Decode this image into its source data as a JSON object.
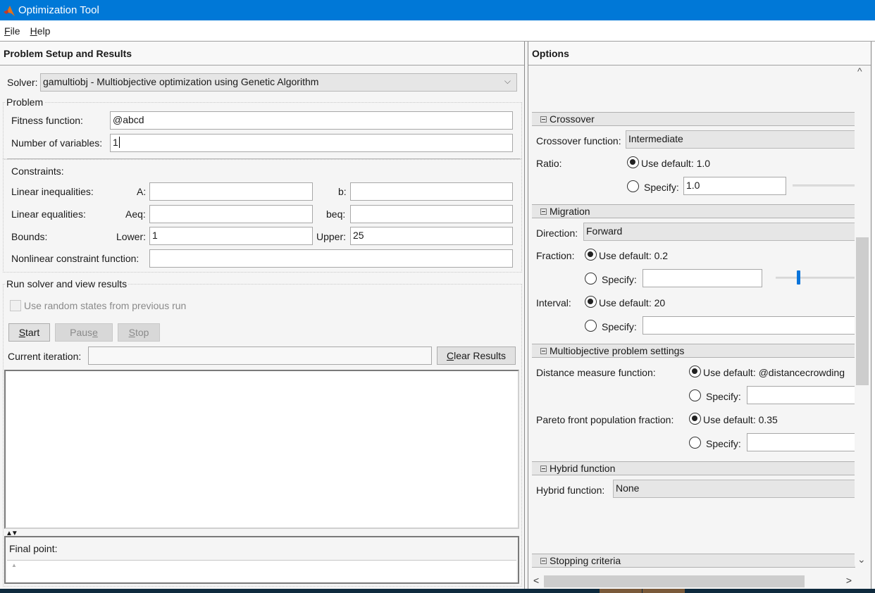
{
  "window": {
    "title": "Optimization Tool"
  },
  "menu": {
    "items": [
      {
        "label": "File",
        "mnemonic": "F",
        "rest": "ile"
      },
      {
        "label": "Help",
        "mnemonic": "H",
        "rest": "elp"
      }
    ]
  },
  "left_panel": {
    "title": "Problem Setup and Results",
    "solver": {
      "label": "Solver:",
      "value": "gamultiobj - Multiobjective optimization using Genetic Algorithm"
    },
    "problem": {
      "title": "Problem",
      "fitness_label": "Fitness function:",
      "fitness_value": "@abcd",
      "numvars_label": "Number of variables:",
      "numvars_value": "1"
    },
    "constraints": {
      "title": "Constraints:",
      "lin_ineq_label": "Linear inequalities:",
      "A_label": "A:",
      "A_value": "",
      "b_label": "b:",
      "b_value": "",
      "lin_eq_label": "Linear equalities:",
      "Aeq_label": "Aeq:",
      "Aeq_value": "",
      "beq_label": "beq:",
      "beq_value": "",
      "bounds_label": "Bounds:",
      "lower_label": "Lower:",
      "lower_value": "1",
      "upper_label": "Upper:",
      "upper_value": "25",
      "nonlin_label": "Nonlinear constraint function:",
      "nonlin_value": ""
    },
    "run": {
      "title": "Run solver and view results",
      "random_states_label": "Use random states from previous run",
      "random_states_checked": false,
      "start": {
        "mn": "S",
        "rest": "tart"
      },
      "pause": {
        "pre": "Paus",
        "mn": "e"
      },
      "stop": {
        "mn": "S",
        "rest": "top"
      },
      "current_iteration_label": "Current iteration:",
      "current_iteration_value": "",
      "clear_results": {
        "mn": "C",
        "rest": "lear Results"
      },
      "results_text": ""
    },
    "final_point": {
      "label": "Final point:",
      "value": ""
    }
  },
  "right_panel": {
    "title": "Options",
    "crossover": {
      "header": "Crossover",
      "function_label": "Crossover function:",
      "function_value": "Intermediate",
      "ratio_label": "Ratio:",
      "ratio_default": "Use default: 1.0",
      "ratio_default_selected": true,
      "ratio_specify": "Specify:",
      "ratio_specify_value": "1.0"
    },
    "migration": {
      "header": "Migration",
      "direction_label": "Direction:",
      "direction_value": "Forward",
      "fraction_label": "Fraction:",
      "fraction_default": "Use default: 0.2",
      "fraction_default_selected": true,
      "fraction_specify": "Specify:",
      "fraction_specify_value": "",
      "fraction_slider_value": 0.1,
      "interval_label": "Interval:",
      "interval_default": "Use default: 20",
      "interval_default_selected": true,
      "interval_specify": "Specify:",
      "interval_specify_value": ""
    },
    "multiobjective": {
      "header": "Multiobjective problem settings",
      "distance_label": "Distance measure function:",
      "distance_default": "Use default: @distancecrowding",
      "distance_default_selected": true,
      "distance_specify": "Specify:",
      "distance_specify_value": "",
      "pareto_label": "Pareto front population fraction:",
      "pareto_default": "Use default: 0.35",
      "pareto_default_selected": true,
      "pareto_specify": "Specify:",
      "pareto_specify_value": ""
    },
    "hybrid": {
      "header": "Hybrid function",
      "function_label": "Hybrid function:",
      "function_value": "None"
    },
    "stopping": {
      "header": "Stopping criteria"
    }
  },
  "icons": {
    "app": "matlab-logo-icon",
    "chevron_down": "⌵",
    "scroll_up": "^",
    "scroll_down": "⌄",
    "scroll_left": "<",
    "scroll_right": ">",
    "splitter": "▲▼",
    "final_tri": "▲"
  },
  "colors": {
    "titlebar": "#0078d7",
    "slider_thumb": "#0a74da"
  }
}
